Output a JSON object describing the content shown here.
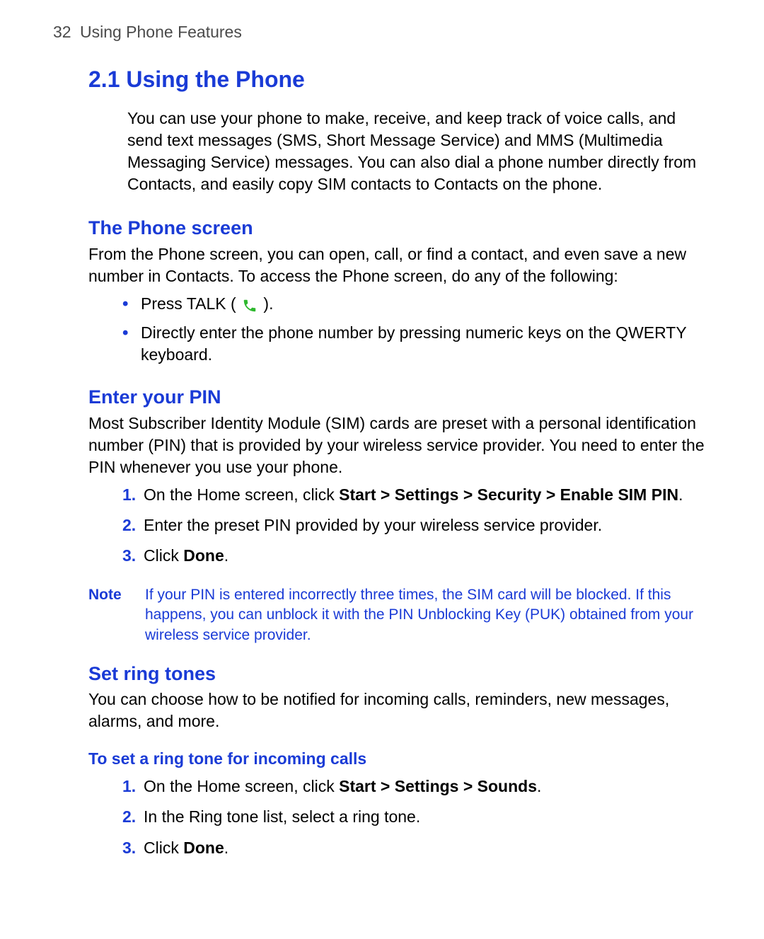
{
  "header": {
    "page_number": "32",
    "chapter_title": "Using Phone Features"
  },
  "section_heading": "2.1 Using the Phone",
  "intro": "You can use your phone to make, receive, and keep track of voice calls, and send text messages (SMS, Short Message Service) and MMS (Multimedia Messaging Service) messages. You can also dial a phone number directly from Contacts, and easily copy SIM contacts to Contacts on the phone.",
  "phone_screen": {
    "heading": "The Phone screen",
    "body": "From the Phone screen, you can open, call, or find a contact, and even save a new number in Contacts. To access the Phone screen, do any of the following:",
    "bullets": [
      {
        "pre": "Press TALK ( ",
        "post": " )."
      },
      {
        "text": "Directly enter the phone number by pressing numeric keys on the QWERTY keyboard."
      }
    ]
  },
  "enter_pin": {
    "heading": "Enter your PIN",
    "body": "Most Subscriber Identity Module (SIM) cards are preset with a personal identification number (PIN) that is provided by your wireless service provider. You need to enter the PIN whenever you use your phone.",
    "steps": [
      {
        "num": "1.",
        "pre": "On the Home screen, click ",
        "bold": "Start > Settings > Security > Enable SIM PIN",
        "post": "."
      },
      {
        "num": "2.",
        "pre": "Enter the preset PIN provided by your wireless service provider.",
        "bold": "",
        "post": ""
      },
      {
        "num": "3.",
        "pre": "Click ",
        "bold": "Done",
        "post": "."
      }
    ],
    "note_label": "Note",
    "note_text": "If your PIN is entered incorrectly three times, the SIM card will be blocked. If this happens, you can unblock it with the PIN Unblocking Key (PUK) obtained from your wireless service provider."
  },
  "ring_tones": {
    "heading": "Set ring tones",
    "body": "You can choose how to be notified for incoming calls, reminders, new messages, alarms, and more.",
    "sub_heading": "To set a ring tone for incoming calls",
    "steps": [
      {
        "num": "1.",
        "pre": "On the Home screen, click ",
        "bold": "Start > Settings > Sounds",
        "post": "."
      },
      {
        "num": "2.",
        "pre": "In the Ring tone list, select a ring tone.",
        "bold": "",
        "post": ""
      },
      {
        "num": "3.",
        "pre": "Click ",
        "bold": "Done",
        "post": "."
      }
    ]
  }
}
